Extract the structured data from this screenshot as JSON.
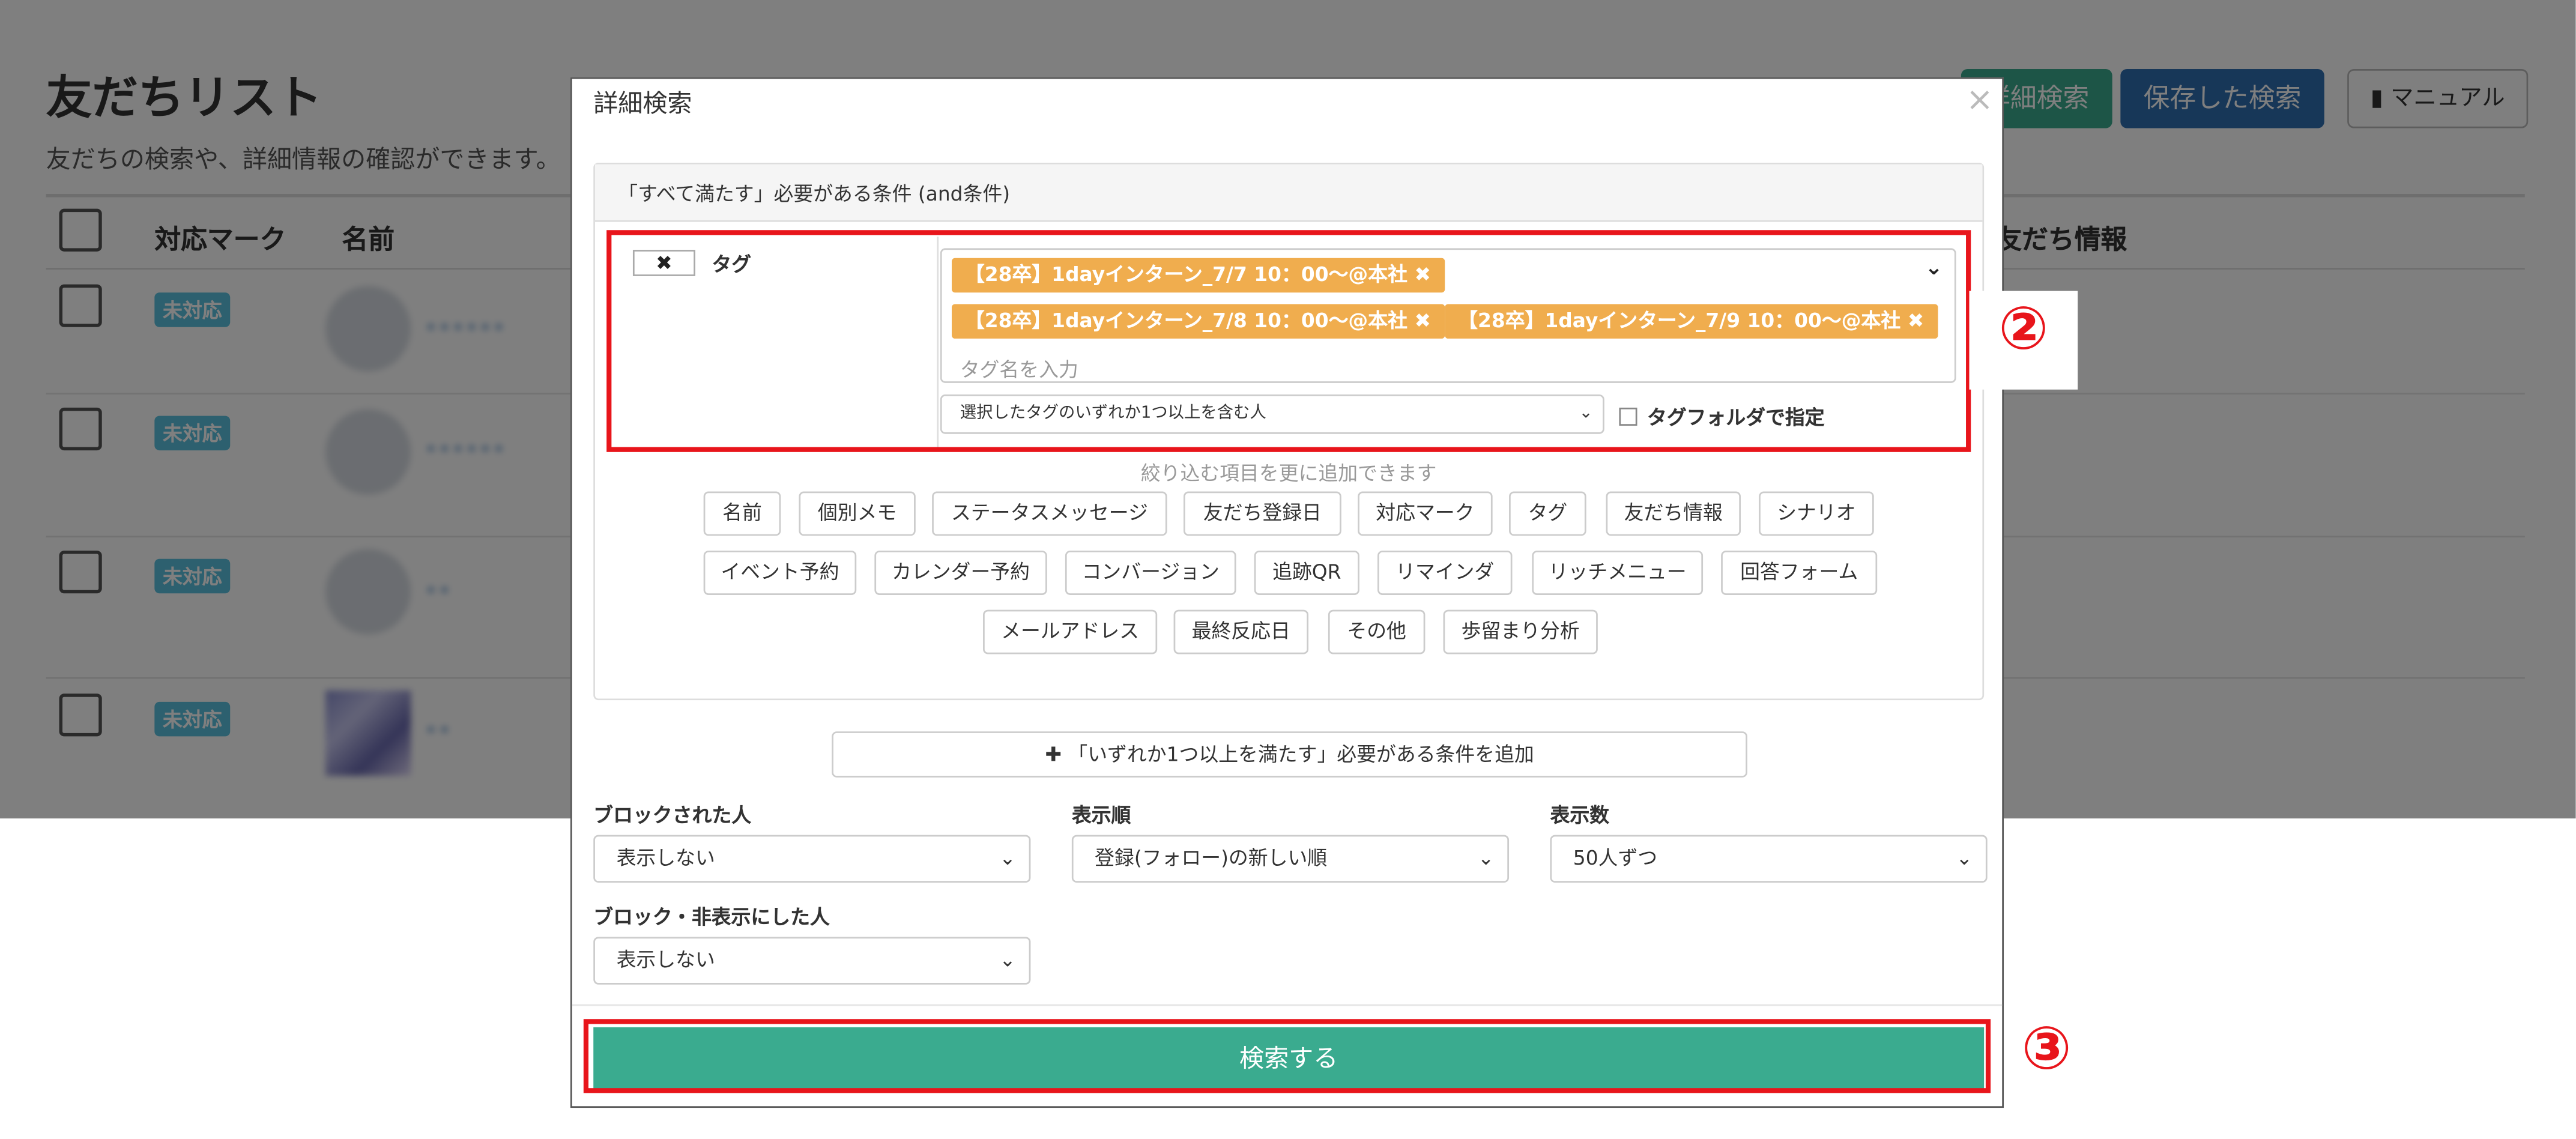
{
  "background": {
    "title": "友だちリスト",
    "subtitle": "友だちの検索や、詳細情報の確認ができます。",
    "columns": [
      "対応マーク",
      "名前",
      "友だち情報"
    ],
    "badge": "未対応",
    "buttons": {
      "detail_search": "詳細検索",
      "saved_search": "保存した検索",
      "manual": "マニュアル"
    }
  },
  "modal": {
    "title": "詳細検索",
    "close": "×",
    "condition_header": "「すべて満たす」必要がある条件 (and条件)",
    "tag_label": "タグ",
    "tags": [
      "【28卒】1dayインターン_7/7 10：00〜@本社",
      "【28卒】1dayインターン_7/8 10：00〜@本社",
      "【28卒】1dayインターン_7/9 10：00〜@本社"
    ],
    "tag_placeholder": "タグ名を入力",
    "match_select": "選択したタグのいずれか1つ以上を含む人",
    "folder_checkbox": "タグフォルダで指定",
    "hint": "絞り込む項目を更に追加できます",
    "filter_buttons": [
      [
        "名前",
        "個別メモ",
        "ステータスメッセージ",
        "友だち登録日",
        "対応マーク",
        "タグ",
        "友だち情報",
        "シナリオ"
      ],
      [
        "イベント予約",
        "カレンダー予約",
        "コンバージョン",
        "追跡QR",
        "リマインダ",
        "リッチメニュー",
        "回答フォーム"
      ],
      [
        "メールアドレス",
        "最終反応日",
        "その他",
        "歩留まり分析"
      ]
    ],
    "add_or_condition": "「いずれか1つ以上を満たす」必要がある条件を追加",
    "blocked": {
      "label": "ブロックされた人",
      "value": "表示しない"
    },
    "order": {
      "label": "表示順",
      "value": "登録(フォロー)の新しい順"
    },
    "count": {
      "label": "表示数",
      "value": "50人ずつ"
    },
    "blocked_hidden": {
      "label": "ブロック・非表示にした人",
      "value": "表示しない"
    },
    "search_button": "検索する"
  },
  "annotations": {
    "step2": "②",
    "step3": "③"
  },
  "colors": {
    "accent": "#3aab8f",
    "tag": "#f0ad4e",
    "highlight": "#e8151b",
    "badge": "#5bc0de"
  }
}
